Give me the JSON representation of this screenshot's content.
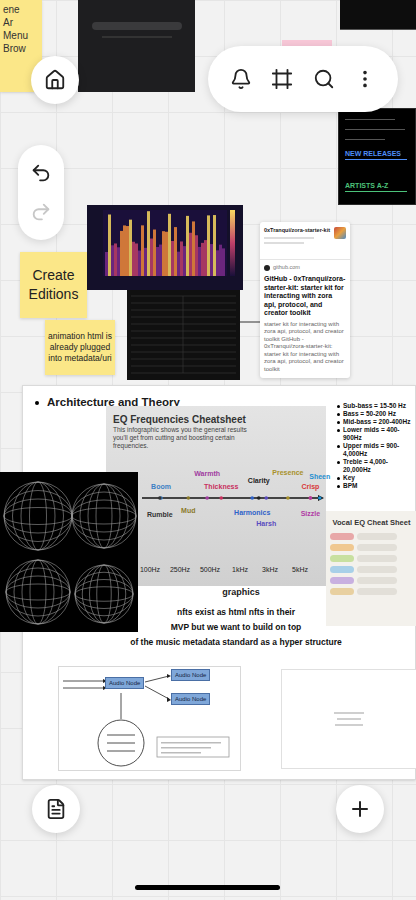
{
  "canvas_toolbar": {
    "undo": {
      "disabled": false
    },
    "redo": {
      "disabled": true
    }
  },
  "partial_note": {
    "lines": [
      "ene",
      "Ar",
      "Menu",
      "Brow"
    ]
  },
  "music_panel": {
    "items": [
      {
        "label": "NEW RELEASES",
        "color": "#4f8ef7"
      },
      {
        "label": "ARTISTS A-Z",
        "color": "#4cc27a"
      }
    ]
  },
  "create_note": {
    "text": "Create Editions"
  },
  "animation_note": {
    "text": "animation html is already plugged into metadata/uri"
  },
  "link_card": {
    "repo": "0xTranqui/zora-starter-kit",
    "site": "github.com",
    "title": "GitHub - 0xTranqui/zora-starter-kit: starter kit for interacting with zora api, protocol, and creator toolkit",
    "description": "starter kit for interacting with zora api, protocol, and creator toolkit GitHub - 0xTranqui/zora-starter-kit: starter kit for interacting with zora api, protocol, and creator toolkit"
  },
  "section": {
    "title": "Architecture and Theory"
  },
  "eq_chart": {
    "title": "EQ Frequencies Cheatsheet",
    "subtitle": "This infographic shows you the general results you'll get from cutting and boosting certain frequencies.",
    "ticks": [
      {
        "label": "100Hz",
        "hz": 100
      },
      {
        "label": "250Hz",
        "hz": 250
      },
      {
        "label": "500Hz",
        "hz": 500
      },
      {
        "label": "1kHz",
        "hz": 1000
      },
      {
        "label": "3kHz",
        "hz": 3000
      },
      {
        "label": "5kHz",
        "hz": 5000
      }
    ],
    "bands": [
      {
        "label": "Boom",
        "hz": 140,
        "gain": 0.3,
        "color": "#3b7fc4"
      },
      {
        "label": "Rumble",
        "hz": 135,
        "gain": -0.6,
        "color": "#333333"
      },
      {
        "label": "Mud",
        "hz": 303,
        "gain": -0.3,
        "color": "#8a7a2a"
      },
      {
        "label": "Warmth",
        "hz": 468,
        "gain": 1.2,
        "color": "#a03ca0"
      },
      {
        "label": "Thickness",
        "hz": 648,
        "gain": 0.3,
        "color": "#c8305e"
      },
      {
        "label": "Clarity",
        "hz": 1987,
        "gain": 0.7,
        "color": "#222222"
      },
      {
        "label": "Harmonics",
        "hz": 1563,
        "gain": -0.4,
        "color": "#2f62c8"
      },
      {
        "label": "Harsh",
        "hz": 2615,
        "gain": -1.2,
        "color": "#5a4bbf"
      },
      {
        "label": "Presence",
        "hz": 4070,
        "gain": 1.3,
        "color": "#a8912a"
      },
      {
        "label": "Crisp",
        "hz": 5970,
        "gain": 0.3,
        "color": "#d83a3a"
      },
      {
        "label": "Sheen",
        "hz": 7000,
        "gain": 1.0,
        "color": "#1f8fd0"
      },
      {
        "label": "Sizzle",
        "hz": 5970,
        "gain": -0.5,
        "color": "#b03aa4"
      }
    ]
  },
  "frequency_list": [
    "Sub-bass = 15-50 Hz",
    "Bass = 50-200 Hz",
    "Mid-bass = 200-400Hz",
    "Lower mids = 400-900Hz",
    "Upper mids = 900-4,000Hz",
    "Treble = 4,000-20,000Hz",
    "Key",
    "BPM"
  ],
  "vocal_sheet": {
    "title": "Vocal EQ Cheat Sheet"
  },
  "caption": "graphics",
  "note": {
    "lines": [
      "nfts exist as html nfts in their",
      "MVP but we want to build on top",
      "of the music metadata standard as a hyper structure"
    ]
  },
  "diagram": {
    "nodes": [
      {
        "label": "Audio Node"
      },
      {
        "label": "Audio Node"
      },
      {
        "label": "Audio Node"
      }
    ]
  }
}
